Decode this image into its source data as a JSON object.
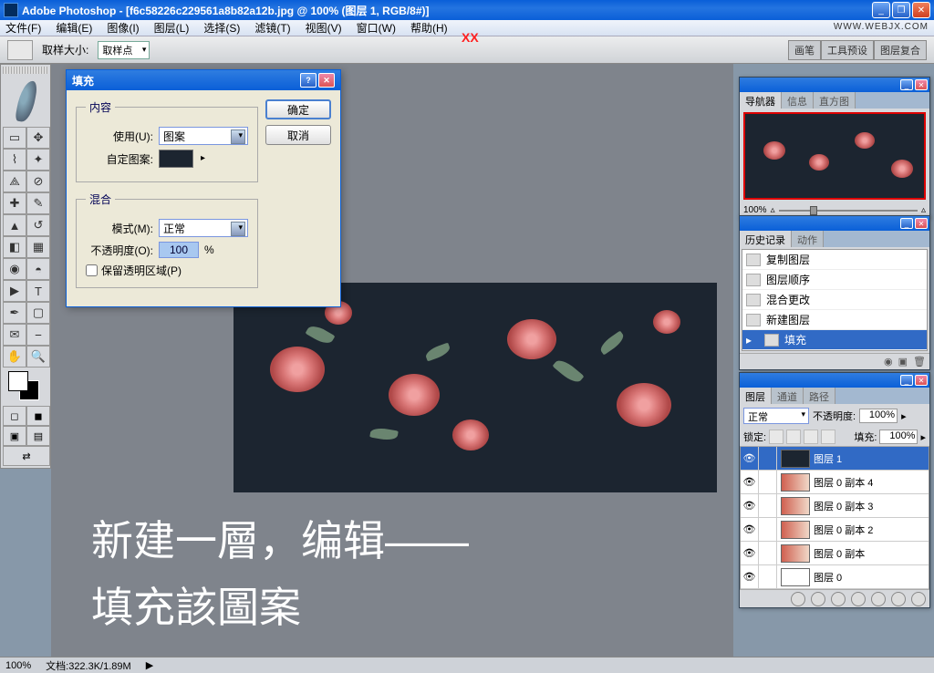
{
  "app": {
    "title": "Adobe Photoshop - [f6c58226c229561a8b82a12b.jpg @ 100% (图层 1, RGB/8#)]",
    "watermark": "WWW.WEBJX.COM"
  },
  "menu": {
    "file": "文件(F)",
    "edit": "编辑(E)",
    "image": "图像(I)",
    "layer": "图层(L)",
    "select": "选择(S)",
    "filter": "滤镜(T)",
    "view": "视图(V)",
    "window": "窗口(W)",
    "help": "帮助(H)"
  },
  "optbar": {
    "sample_label": "取样大小:",
    "sample_value": "取样点"
  },
  "opt_tabs": {
    "brushes": "画笔",
    "tool_presets": "工具预设",
    "layer_comps": "图层复合"
  },
  "dialog": {
    "title": "填充",
    "content_legend": "内容",
    "use_label": "使用(U):",
    "use_value": "图案",
    "custom_label": "自定图案:",
    "blend_legend": "混合",
    "mode_label": "模式(M):",
    "mode_value": "正常",
    "opacity_label": "不透明度(O):",
    "opacity_value": "100",
    "opacity_pct": "%",
    "preserve": "保留透明区域(P)",
    "ok": "确定",
    "cancel": "取消"
  },
  "nav": {
    "tab1": "导航器",
    "tab2": "信息",
    "tab3": "直方图",
    "zoom": "100%"
  },
  "history": {
    "tab1": "历史记录",
    "tab2": "动作",
    "items": [
      "复制图层",
      "图层顺序",
      "混合更改",
      "新建图层",
      "填充"
    ]
  },
  "layers": {
    "tab1": "图层",
    "tab2": "通道",
    "tab3": "路径",
    "blend": "正常",
    "op_label": "不透明度:",
    "op_value": "100%",
    "lock_label": "锁定:",
    "fill_label": "填充:",
    "fill_value": "100%",
    "rows": [
      {
        "name": "图层 1",
        "sel": true,
        "thumb": "pattern"
      },
      {
        "name": "图层 0 副本 4",
        "thumb": "grad"
      },
      {
        "name": "图层 0 副本 3",
        "thumb": "grad"
      },
      {
        "name": "图层 0 副本 2",
        "thumb": "grad"
      },
      {
        "name": "图层 0 副本",
        "thumb": "grad"
      },
      {
        "name": "图层 0",
        "thumb": "white"
      }
    ]
  },
  "status": {
    "zoom": "100%",
    "doc": "文档:322.3K/1.89M"
  },
  "annotation": {
    "line1": "新建一層，编辑——",
    "line2": "填充該圖案"
  },
  "red_x": "XX"
}
